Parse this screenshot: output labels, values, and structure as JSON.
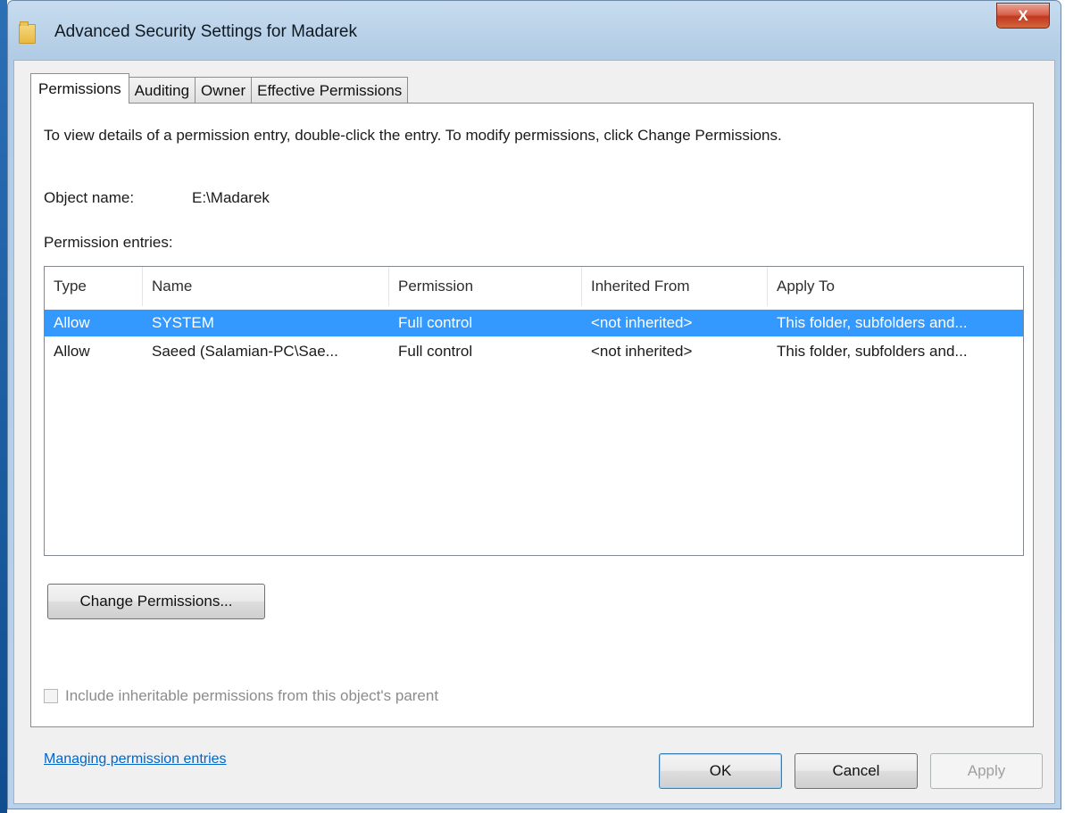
{
  "window": {
    "title": "Advanced Security Settings for Madarek",
    "close_label": "X"
  },
  "tabs": [
    {
      "label": "Permissions",
      "active": true
    },
    {
      "label": "Auditing",
      "active": false
    },
    {
      "label": "Owner",
      "active": false
    },
    {
      "label": "Effective Permissions",
      "active": false
    }
  ],
  "content": {
    "description": "To view details of a permission entry, double-click the entry. To modify permissions, click Change Permissions.",
    "object_name_label": "Object name:",
    "object_name_value": "E:\\Madarek",
    "entries_label": "Permission entries:"
  },
  "table": {
    "columns": [
      "Type",
      "Name",
      "Permission",
      "Inherited From",
      "Apply To"
    ],
    "rows": [
      {
        "type": "Allow",
        "name": "SYSTEM",
        "permission": "Full control",
        "inherited_from": "<not inherited>",
        "apply_to": "This folder, subfolders and...",
        "selected": true
      },
      {
        "type": "Allow",
        "name": "Saeed (Salamian-PC\\Sae...",
        "permission": "Full control",
        "inherited_from": "<not inherited>",
        "apply_to": "This folder, subfolders and...",
        "selected": false
      }
    ]
  },
  "change_permissions_label": "Change Permissions...",
  "inherit_checkbox": {
    "label": "Include inheritable permissions from this object's parent",
    "checked": false,
    "enabled": false
  },
  "help_link": "Managing permission entries",
  "footer": {
    "ok_label": "OK",
    "cancel_label": "Cancel",
    "apply_label": "Apply"
  },
  "colors": {
    "selection": "#3399ff",
    "link": "#0066cc",
    "close_button": "#c7402a"
  }
}
